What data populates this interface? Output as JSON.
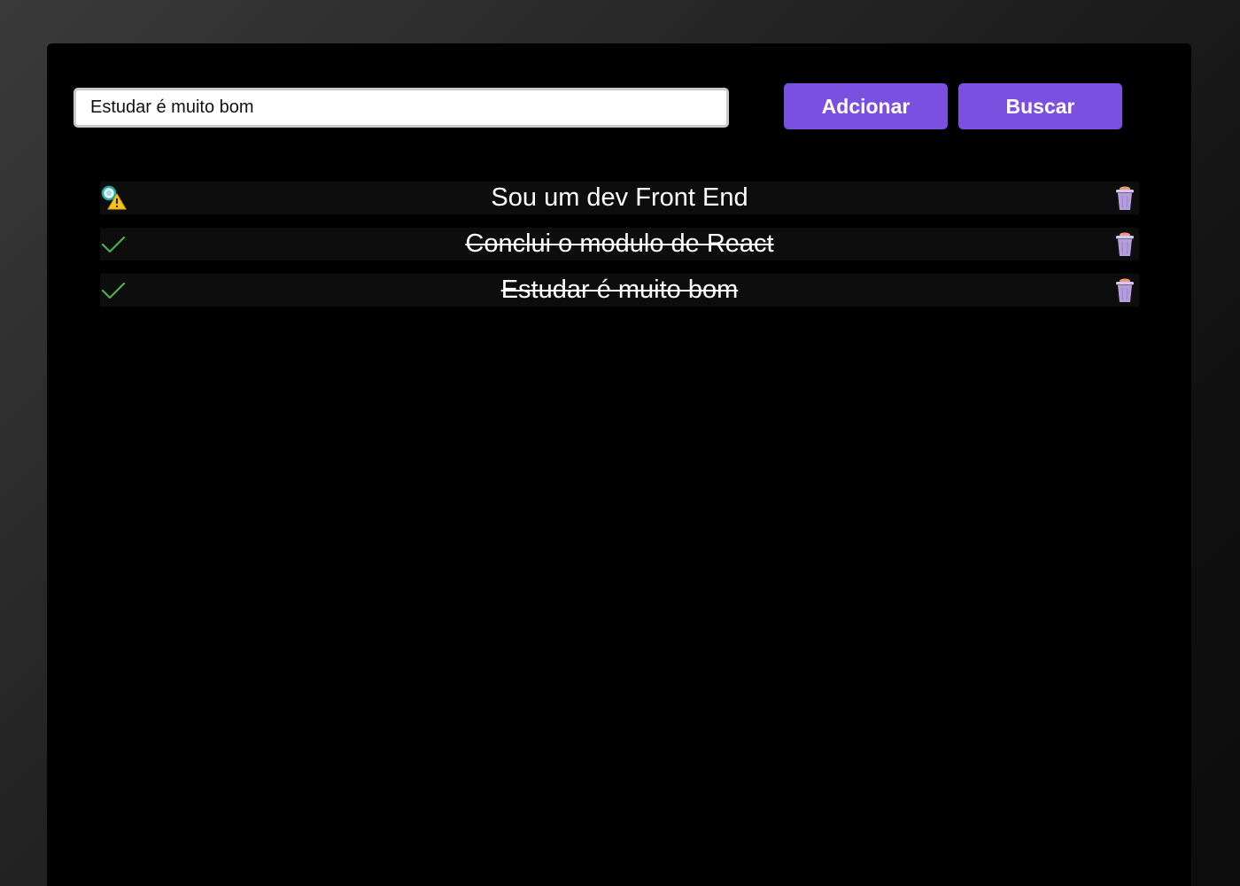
{
  "form": {
    "input_value": "Estudar é muito bom",
    "add_label": "Adcionar",
    "search_label": "Buscar"
  },
  "tasks": [
    {
      "text": "Sou um dev Front End",
      "status": "pending",
      "status_icon": "pending-warning-icon"
    },
    {
      "text": "Conclui o modulo de React",
      "status": "done",
      "status_icon": "check-icon"
    },
    {
      "text": "Estudar é muito bom",
      "status": "done",
      "status_icon": "check-icon"
    }
  ],
  "colors": {
    "accent": "#7b4fe0",
    "check": "#4caf50",
    "trash": "#b39ddb",
    "trash_lid": "#ef9a7a"
  }
}
